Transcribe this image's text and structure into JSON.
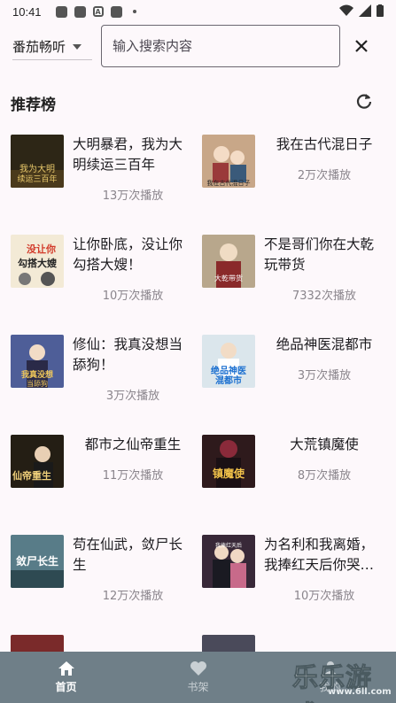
{
  "status_bar": {
    "time": "10:41"
  },
  "search": {
    "source": "番茄畅听",
    "placeholder": "输入搜索内容"
  },
  "section": {
    "title": "推荐榜"
  },
  "books": [
    {
      "title": "大明暴君，我为大明续运三百年",
      "plays": "13万次播放",
      "cover_color": "#3a3020"
    },
    {
      "title": "我在古代混日子",
      "plays": "2万次播放",
      "cover_color": "#c9a98a"
    },
    {
      "title": "让你卧底，没让你勾搭大嫂！",
      "plays": "10万次播放",
      "cover_color": "#f2e9d8"
    },
    {
      "title": "不是哥们你在大乾玩带货",
      "plays": "7332次播放",
      "cover_color": "#b9a88e"
    },
    {
      "title": "修仙：我真没想当舔狗！",
      "plays": "3万次播放",
      "cover_color": "#5d6fa8"
    },
    {
      "title": "绝品神医混都市",
      "plays": "3万次播放",
      "cover_color": "#d8e4ea"
    },
    {
      "title": "都市之仙帝重生",
      "plays": "11万次播放",
      "cover_color": "#2a2418"
    },
    {
      "title": "大荒镇魔使",
      "plays": "8万次播放",
      "cover_color": "#3a1e20"
    },
    {
      "title": "苟在仙武，敛尸长生",
      "plays": "12万次播放",
      "cover_color": "#5a7f8a"
    },
    {
      "title": "为名利和我离婚，我捧红天后你哭什么",
      "plays": "10万次播放",
      "cover_color": "#3a2a3a"
    }
  ],
  "bottom_nav": [
    {
      "label": "首页",
      "icon": "home-icon",
      "active": true
    },
    {
      "label": "书架",
      "icon": "heart-icon",
      "active": false
    },
    {
      "label": "我的",
      "icon": "person-icon",
      "active": false
    }
  ],
  "watermark": {
    "text": "乐乐游戏",
    "url": "www.6ll.com"
  }
}
